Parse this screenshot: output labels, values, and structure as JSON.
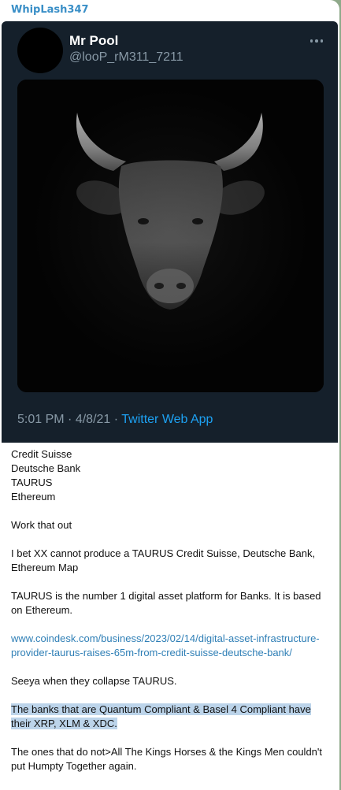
{
  "message": {
    "sender": "WhipLash347",
    "tweet": {
      "name": "Mr Pool",
      "handle": "@looP_rM311_7211",
      "image": "bull-photo",
      "time": "5:01 PM",
      "date": "4/8/21",
      "separator": "·",
      "app": "Twitter Web App",
      "more_icon": "more-dots-icon"
    },
    "lines": [
      "Credit Suisse",
      "Deutsche Bank",
      "TAURUS",
      "Ethereum"
    ],
    "p1": "Work that out",
    "p2": "I bet XX cannot produce a TAURUS Credit Suisse, Deutsche Bank, Ethereum Map",
    "p3": "TAURUS is the number 1 digital asset platform for Banks. It is based on Ethereum.",
    "link": "www.coindesk.com/business/2023/02/14/digital-asset-infrastructure-provider-taurus-raises-65m-from-credit-suisse-deutsche-bank/",
    "p4": "Seeya when they collapse TAURUS.",
    "p5": "The banks that are Quantum Compliant & Basel 4 Compliant have their XRP, XLM & XDC.",
    "p6": "The ones that do not>All The Kings Horses & the Kings Men couldn't put Humpty Together again."
  },
  "colors": {
    "background": "#8fa98a",
    "sender": "#3a8fc7",
    "tweet_bg": "#15202b",
    "twitter_blue": "#1da1f2",
    "link": "#2f7fb6",
    "selection": "#bcd4ea"
  }
}
